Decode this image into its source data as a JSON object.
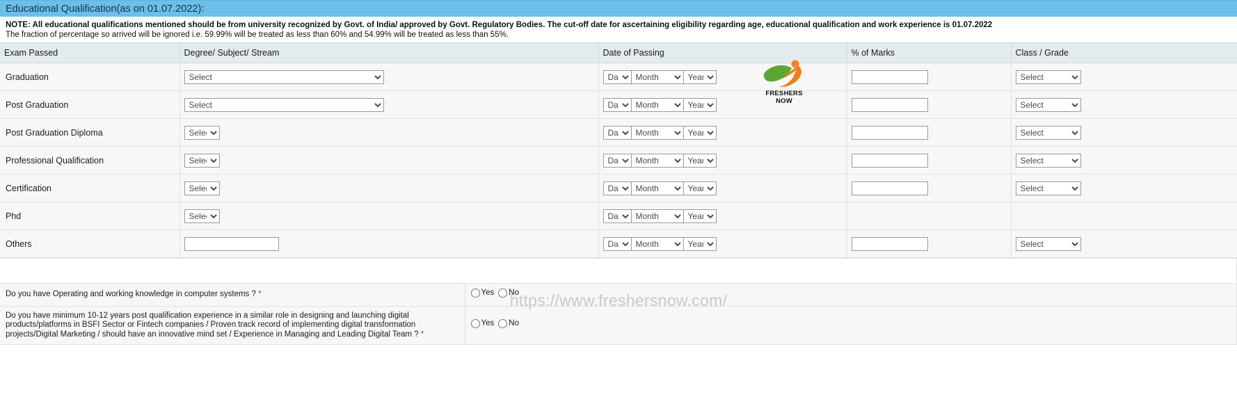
{
  "section": {
    "title": "Educational Qualification(as on 01.07.2022):"
  },
  "note": {
    "prefix": "NOTE: ",
    "line1": "All educational qualifications mentioned should be from university recognized by Govt. of India/ approved by Govt. Regulatory Bodies. The cut-off date for ascertaining eligibility regarding age, educational qualification and work experience is 01.07.2022",
    "line2": "The fraction of percentage so arrived will be ignored i.e. 59.99% will be treated as less than 60% and 54.99% will be treated as less than 55%."
  },
  "table": {
    "headers": [
      "Exam Passed",
      "Degree/ Subject/ Stream",
      "Date of Passing",
      "% of Marks",
      "Class / Grade"
    ],
    "placeholders": {
      "select": "Select",
      "day": "Day",
      "month": "Month",
      "year": "Year"
    },
    "rows": [
      {
        "exam": "Graduation",
        "degree_control": "select-wide",
        "degree_value": "Select",
        "date": true,
        "marks": true,
        "grade": "Select"
      },
      {
        "exam": "Post Graduation",
        "degree_control": "select-wide",
        "degree_value": "Select",
        "date": true,
        "marks": true,
        "grade": "Select"
      },
      {
        "exam": "Post Graduation Diploma",
        "degree_control": "select-small",
        "degree_value": "Select",
        "date": true,
        "marks": true,
        "grade": "Select"
      },
      {
        "exam": "Professional Qualification",
        "degree_control": "select-small",
        "degree_value": "Select",
        "date": true,
        "marks": true,
        "grade": "Select"
      },
      {
        "exam": "Certification",
        "degree_control": "select-small",
        "degree_value": "Select",
        "date": true,
        "marks": true,
        "grade": "Select"
      },
      {
        "exam": "Phd",
        "degree_control": "select-small",
        "degree_value": "Select",
        "date": true,
        "marks": false,
        "grade": null
      },
      {
        "exam": "Others",
        "degree_control": "text",
        "degree_value": "",
        "date": true,
        "marks": true,
        "grade": "Select"
      }
    ]
  },
  "logo": {
    "text": "FRESHERS NOW",
    "green": "#5aa832",
    "orange": "#f07d1a"
  },
  "watermark": {
    "text": "https://www.freshersnow.com/"
  },
  "questions": [
    {
      "text": "Do you have Operating and working knowledge in computer systems ? ",
      "required": "*",
      "options": [
        "Yes",
        "No"
      ]
    },
    {
      "text": "Do you have minimum 10-12 years post qualification experience in a similar role in designing and launching digital products/platforms in BSFI Sector or Fintech companies / Proven track record of implementing digital transformation projects/Digital Marketing / should have an innovative mind set / Experience in Managing and Leading Digital Team ? ",
      "required": "*",
      "options": [
        "Yes",
        "No"
      ]
    }
  ]
}
